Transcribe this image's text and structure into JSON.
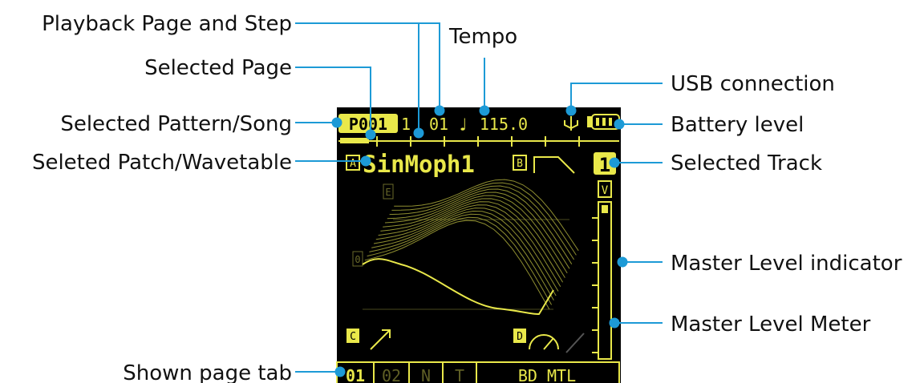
{
  "screen": {
    "pattern": "P001",
    "page": "1",
    "step": "01",
    "note_symbol": "♩",
    "tempo": "115.0",
    "slot_a": "A",
    "patch_name": "SinMoph1",
    "slot_b": "B",
    "track": "1",
    "meter_label": "V",
    "axis_e": "E",
    "axis_0": "0",
    "slot_c": "C",
    "slot_d": "D",
    "tabs": [
      "01",
      "02",
      "N",
      "T",
      "BD MTL"
    ]
  },
  "labels": {
    "playback_page_step": "Playback Page and Step",
    "tempo": "Tempo",
    "selected_page": "Selected Page",
    "usb_connection": "USB connection",
    "selected_pattern_song": "Selected Pattern/Song",
    "battery_level": "Battery level",
    "selected_patch_wavetable": "Seleted Patch/Wavetable",
    "selected_track": "Selected Track",
    "master_level_indicator": "Master Level indicator",
    "master_level_meter": "Master Level Meter",
    "shown_page_tab": "Shown page tab"
  },
  "colors": {
    "screen_bg": "#000000",
    "screen_fg": "#e9e84a",
    "leader": "#1d9ad6",
    "text": "#111111"
  },
  "icons": [
    "usb-icon",
    "battery-icon",
    "envelope-icon",
    "arrow-icon",
    "knob-icon"
  ]
}
